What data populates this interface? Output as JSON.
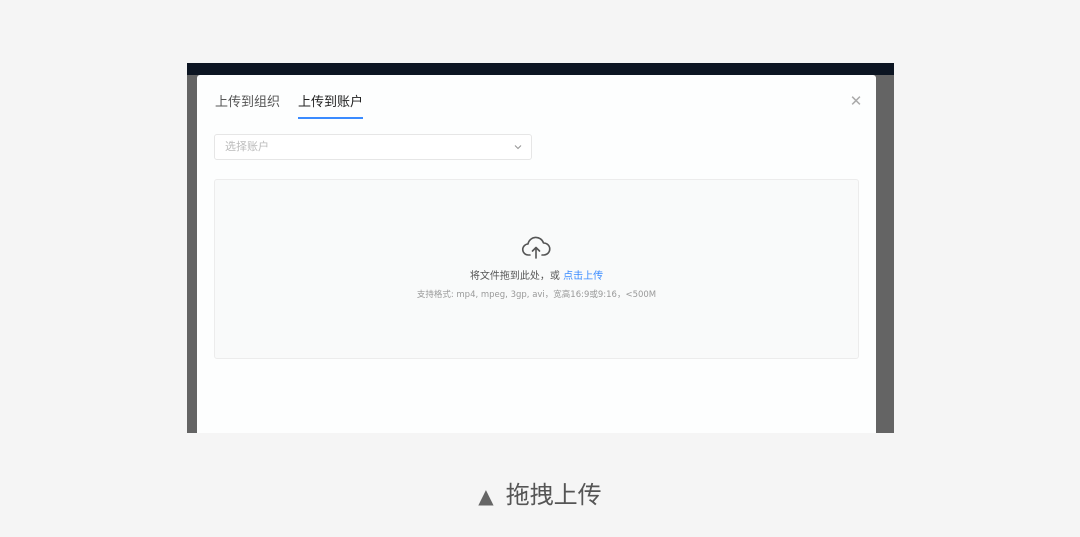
{
  "modal": {
    "tabs": [
      {
        "label": "上传到组织",
        "active": false
      },
      {
        "label": "上传到账户",
        "active": true
      }
    ],
    "close_icon": "close-icon",
    "account_select": {
      "placeholder": "选择账户",
      "icon": "chevron-down-icon"
    },
    "dropzone": {
      "icon": "cloud-upload-icon",
      "hint_prefix": "将文件拖到此处，或",
      "hint_link": "点击上传",
      "formats": "支持格式: mp4, mpeg, 3gp, avi，宽高16:9或9:16，<500M"
    },
    "accent_color": "#3a8bff"
  },
  "caption": {
    "marker": "▲",
    "text": "拖拽上传"
  }
}
